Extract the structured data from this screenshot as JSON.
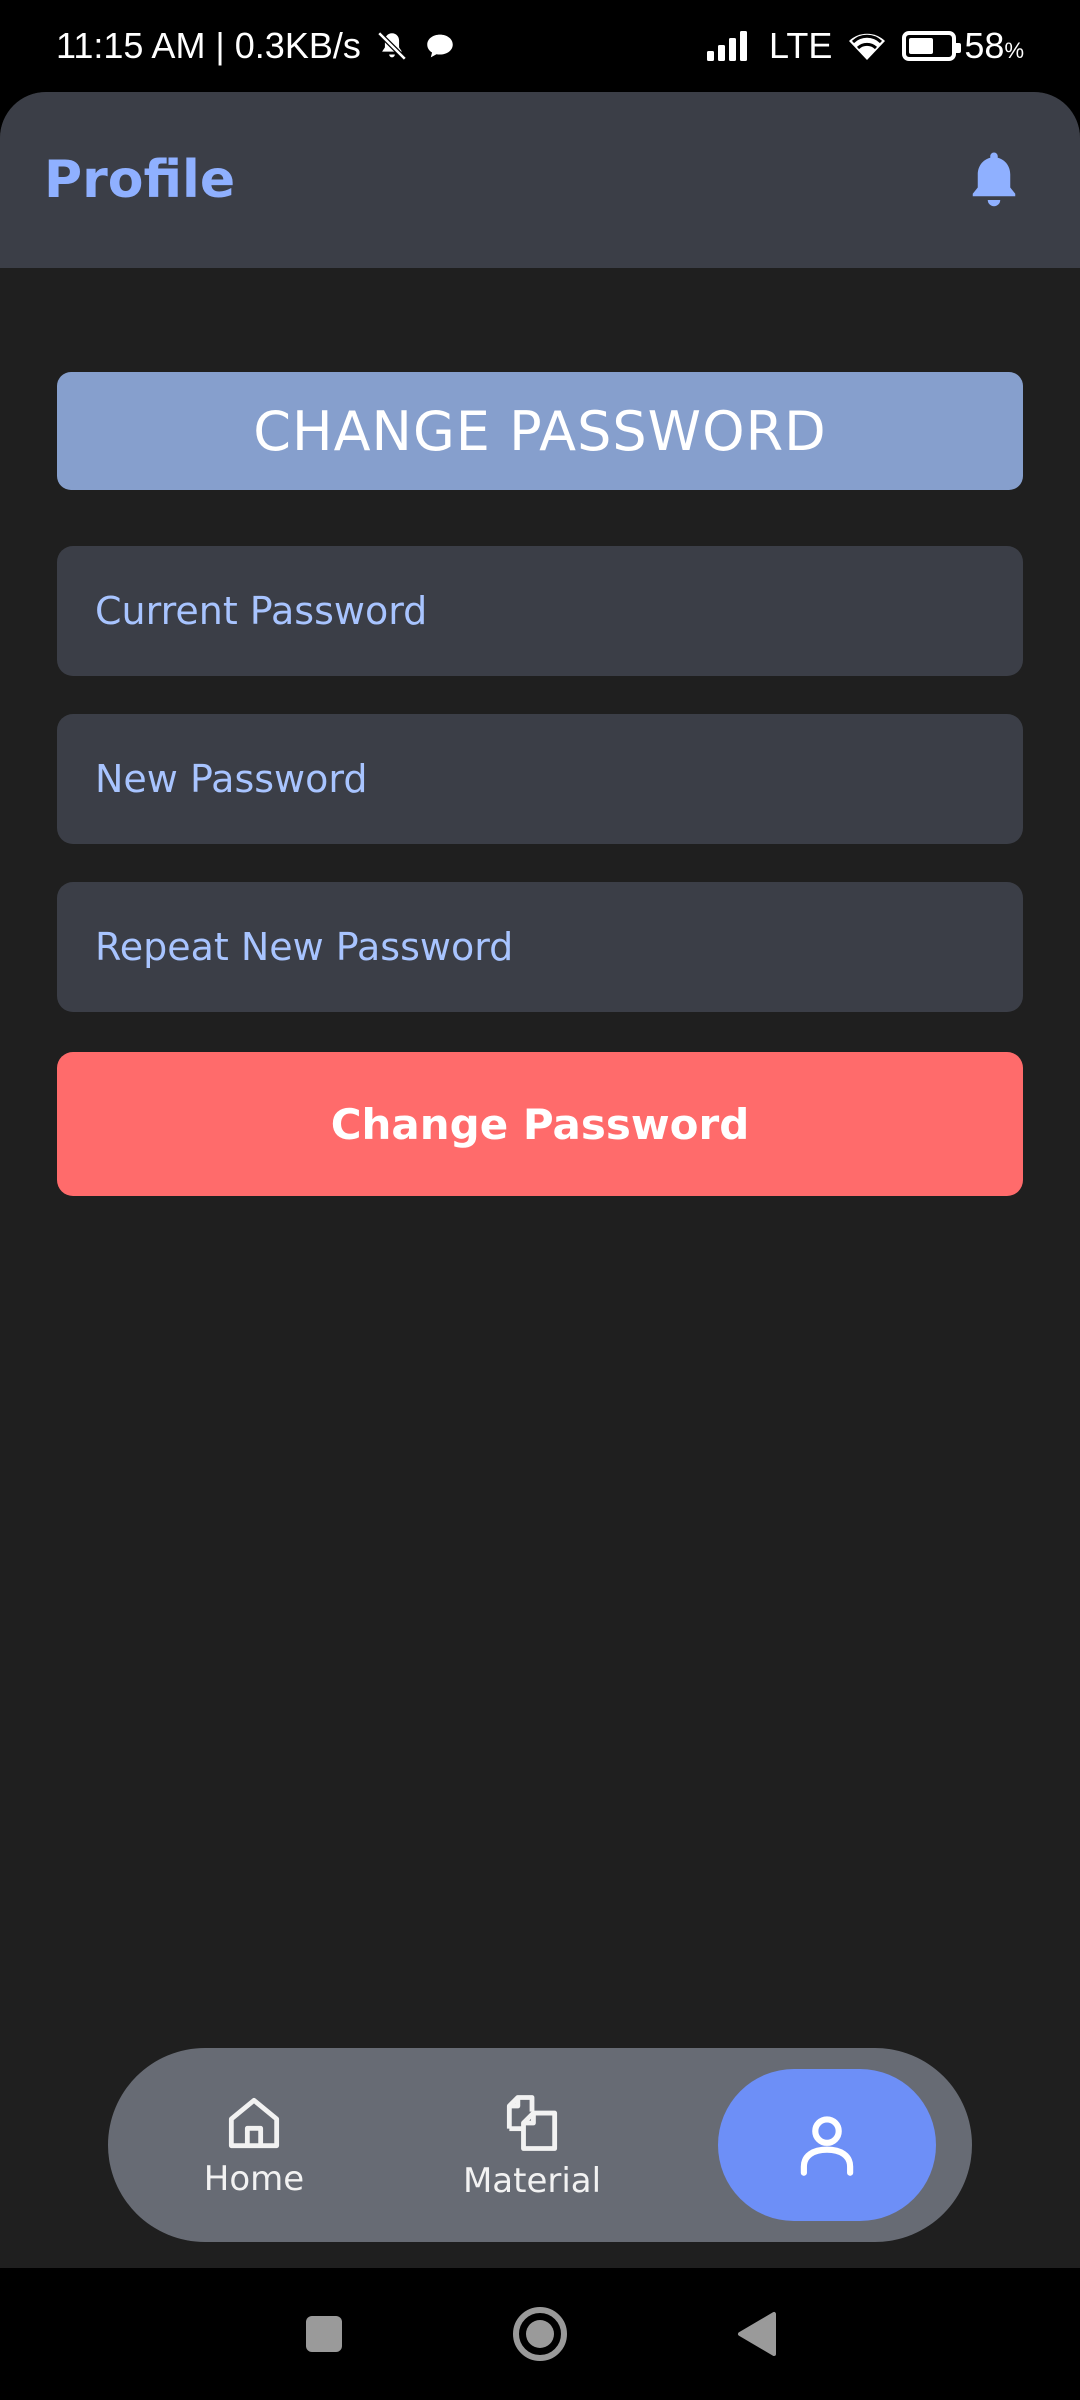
{
  "status_bar": {
    "time_speed": "11:15 AM | 0.3KB/s",
    "network": "LTE",
    "battery_percent": "58",
    "battery_unit": "%",
    "battery_level": 0.58,
    "icons": [
      "mute-icon",
      "chat-bubble-icon",
      "signal-icon",
      "wifi-icon",
      "battery-icon"
    ]
  },
  "header": {
    "title": "Profile",
    "bell_icon": "bell-icon"
  },
  "colors": {
    "accent": "#8fb0ff",
    "banner": "#869fcd",
    "danger_button": "#ff6b6b",
    "field_bg": "#3b3e47",
    "nav_active": "#6d8ff7"
  },
  "change_password": {
    "section_title": "CHANGE PASSWORD",
    "current_placeholder": "Current Password",
    "new_placeholder": "New Password",
    "repeat_placeholder": "Repeat New Password",
    "submit_label": "Change Password"
  },
  "bottom_nav": {
    "items": [
      {
        "label": "Home",
        "icon": "home-icon"
      },
      {
        "label": "Material",
        "icon": "documents-icon"
      },
      {
        "label": "",
        "icon": "profile-icon",
        "active": true
      }
    ]
  },
  "system_nav": [
    "recents-square-icon",
    "home-circle-icon",
    "back-triangle-icon"
  ]
}
